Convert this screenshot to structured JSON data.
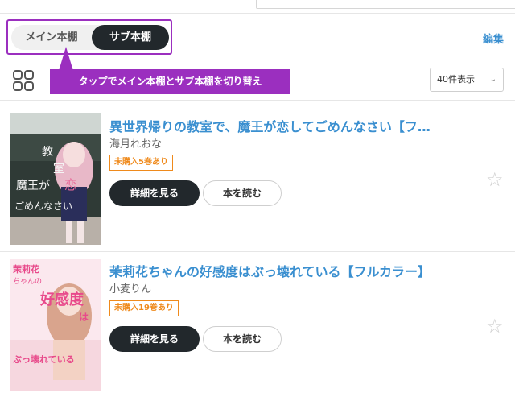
{
  "shelf": {
    "main_label": "メイン本棚",
    "sub_label": "サブ本棚",
    "edit_label": "編集"
  },
  "tooltip": {
    "text": "タップでメイン本棚とサブ本棚を切り替え"
  },
  "view": {
    "per_page": "40件表示",
    "grid_icon": "grid-icon",
    "chevron_icon": "chevron-down-icon"
  },
  "books": [
    {
      "title": "異世界帰りの教室で、魔王が恋してごめんなさい【フ…",
      "author": "海月れおな",
      "badge": "未購入5巻あり",
      "detail_label": "詳細を見る",
      "read_label": "本を読む",
      "cover_text": {
        "line1": "教",
        "line2": "室",
        "line3": "魔王が",
        "line4": "恋",
        "line5": "ごめんなさい"
      }
    },
    {
      "title": "茉莉花ちゃんの好感度はぶっ壊れている【フルカラー】",
      "author": "小麦りん",
      "badge": "未購入19巻あり",
      "detail_label": "詳細を見る",
      "read_label": "本を読む",
      "cover_text": {
        "line1": "茉莉花",
        "line2": "ちゃんの",
        "line3": "好感度",
        "line4": "は",
        "line5": "ぶっ壊れている"
      }
    }
  ],
  "colors": {
    "accent": "#9b2fbf",
    "link": "#3a8fd0",
    "badge": "#ef8a1c",
    "dark": "#22282c"
  }
}
